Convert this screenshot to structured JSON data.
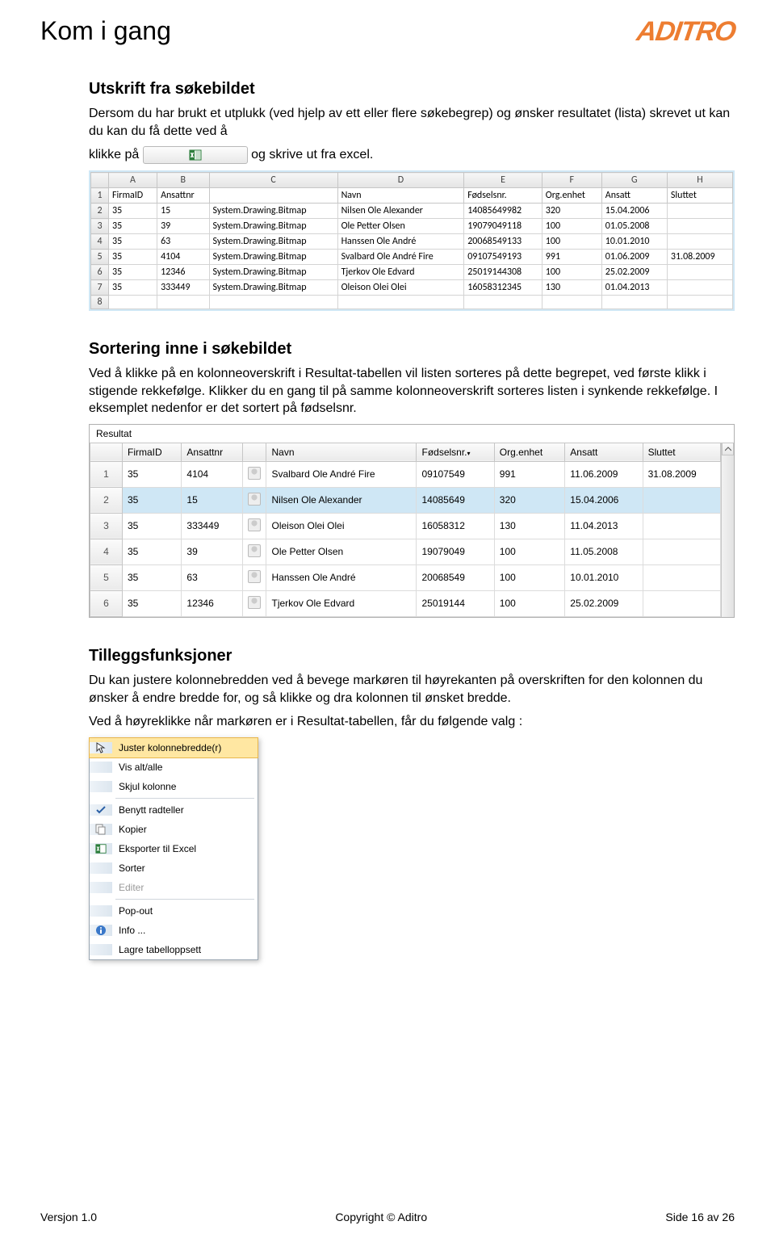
{
  "header": {
    "page_title": "Kom i gang",
    "logo_text": "ADITRO"
  },
  "sections": {
    "utskrift": {
      "heading": "Utskrift fra søkebildet",
      "p1_a": "Dersom du har brukt et utplukk (ved hjelp av ett eller flere søkebegrep) og ønsker resultatet (lista) skrevet ut kan du kan du få dette ved å",
      "p1_b": "klikke på ",
      "p1_c": " og skrive ut fra excel."
    },
    "sortering": {
      "heading": "Sortering inne i søkebildet",
      "p1": "Ved å klikke på en kolonneoverskrift i Resultat-tabellen vil listen sorteres på dette begrepet, ved første klikk i stigende rekkefølge. Klikker du en gang til på samme kolonneoverskrift sorteres listen i synkende rekkefølge. I eksemplet nedenfor er det sortert på fødselsnr."
    },
    "tillegg": {
      "heading": "Tilleggsfunksjoner",
      "p1": "Du kan justere kolonnebredden ved å bevege markøren til høyrekanten på overskriften for den kolonnen du ønsker å endre bredde for, og så klikke og dra kolonnen til ønsket bredde.",
      "p2": "Ved å høyreklikke når markøren er i Resultat-tabellen, får du følgende valg :"
    }
  },
  "excel_table": {
    "col_letters": [
      "A",
      "B",
      "C",
      "D",
      "E",
      "F",
      "G",
      "H"
    ],
    "headers": [
      "FirmaID",
      "Ansattnr",
      "",
      "Navn",
      "Fødselsnr.",
      "Org.enhet",
      "Ansatt",
      "Sluttet"
    ],
    "rows": [
      {
        "n": "1",
        "cells": [
          "FirmaID",
          "Ansattnr",
          "",
          "Navn",
          "Fødselsnr.",
          "Org.enhet",
          "Ansatt",
          "Sluttet"
        ]
      },
      {
        "n": "2",
        "cells": [
          "35",
          "15",
          "System.Drawing.Bitmap",
          "Nilsen Ole Alexander",
          "14085649982",
          "320",
          "15.04.2006",
          ""
        ]
      },
      {
        "n": "3",
        "cells": [
          "35",
          "39",
          "System.Drawing.Bitmap",
          "Ole Petter Olsen",
          "19079049118",
          "100",
          "01.05.2008",
          ""
        ]
      },
      {
        "n": "4",
        "cells": [
          "35",
          "63",
          "System.Drawing.Bitmap",
          "Hanssen Ole André",
          "20068549133",
          "100",
          "10.01.2010",
          ""
        ]
      },
      {
        "n": "5",
        "cells": [
          "35",
          "4104",
          "System.Drawing.Bitmap",
          "Svalbard Ole André Fire",
          "09107549193",
          "991",
          "01.06.2009",
          "31.08.2009"
        ]
      },
      {
        "n": "6",
        "cells": [
          "35",
          "12346",
          "System.Drawing.Bitmap",
          "Tjerkov Ole Edvard",
          "25019144308",
          "100",
          "25.02.2009",
          ""
        ]
      },
      {
        "n": "7",
        "cells": [
          "35",
          "333449",
          "System.Drawing.Bitmap",
          "Oleison Olei Olei",
          "16058312345",
          "130",
          "01.04.2013",
          ""
        ]
      }
    ],
    "last_row_n": "8"
  },
  "result_grid": {
    "title": "Resultat",
    "headers": [
      "FirmaID",
      "Ansattnr",
      "",
      "Navn",
      "Fødselsnr.",
      "Org.enhet",
      "Ansatt",
      "Sluttet"
    ],
    "rows": [
      {
        "n": "1",
        "firma": "35",
        "ansattnr": "4104",
        "navn": "Svalbard Ole André Fire",
        "fnr": "09107549",
        "org": "991",
        "ansatt": "11.06.2009",
        "sluttet": "31.08.2009"
      },
      {
        "n": "2",
        "firma": "35",
        "ansattnr": "15",
        "navn": "Nilsen Ole Alexander",
        "fnr": "14085649",
        "org": "320",
        "ansatt": "15.04.2006",
        "sluttet": "",
        "sel": true
      },
      {
        "n": "3",
        "firma": "35",
        "ansattnr": "333449",
        "navn": "Oleison Olei Olei",
        "fnr": "16058312",
        "org": "130",
        "ansatt": "11.04.2013",
        "sluttet": ""
      },
      {
        "n": "4",
        "firma": "35",
        "ansattnr": "39",
        "navn": "Ole Petter Olsen",
        "fnr": "19079049",
        "org": "100",
        "ansatt": "11.05.2008",
        "sluttet": ""
      },
      {
        "n": "5",
        "firma": "35",
        "ansattnr": "63",
        "navn": "Hanssen Ole André",
        "fnr": "20068549",
        "org": "100",
        "ansatt": "10.01.2010",
        "sluttet": ""
      },
      {
        "n": "6",
        "firma": "35",
        "ansattnr": "12346",
        "navn": "Tjerkov Ole Edvard",
        "fnr": "25019144",
        "org": "100",
        "ansatt": "25.02.2009",
        "sluttet": ""
      }
    ]
  },
  "context_menu": {
    "items": [
      {
        "label": "Juster kolonnebredde(r)",
        "icon": "cursor-icon",
        "highlight": true
      },
      {
        "label": "Vis alt/alle"
      },
      {
        "label": "Skjul kolonne"
      },
      {
        "sep": true
      },
      {
        "label": "Benytt radteller",
        "icon": "check-icon"
      },
      {
        "label": "Kopier",
        "icon": "copy-icon"
      },
      {
        "label": "Eksporter til Excel",
        "icon": "excel-icon"
      },
      {
        "label": "Sorter"
      },
      {
        "label": "Editer",
        "disabled": true
      },
      {
        "sep": true
      },
      {
        "label": "Pop-out"
      },
      {
        "label": "Info ...",
        "icon": "info-icon"
      },
      {
        "label": "Lagre tabelloppsett"
      }
    ]
  },
  "footer": {
    "left": "Versjon 1.0",
    "center": "Copyright © Aditro",
    "right": "Side 16 av 26"
  }
}
